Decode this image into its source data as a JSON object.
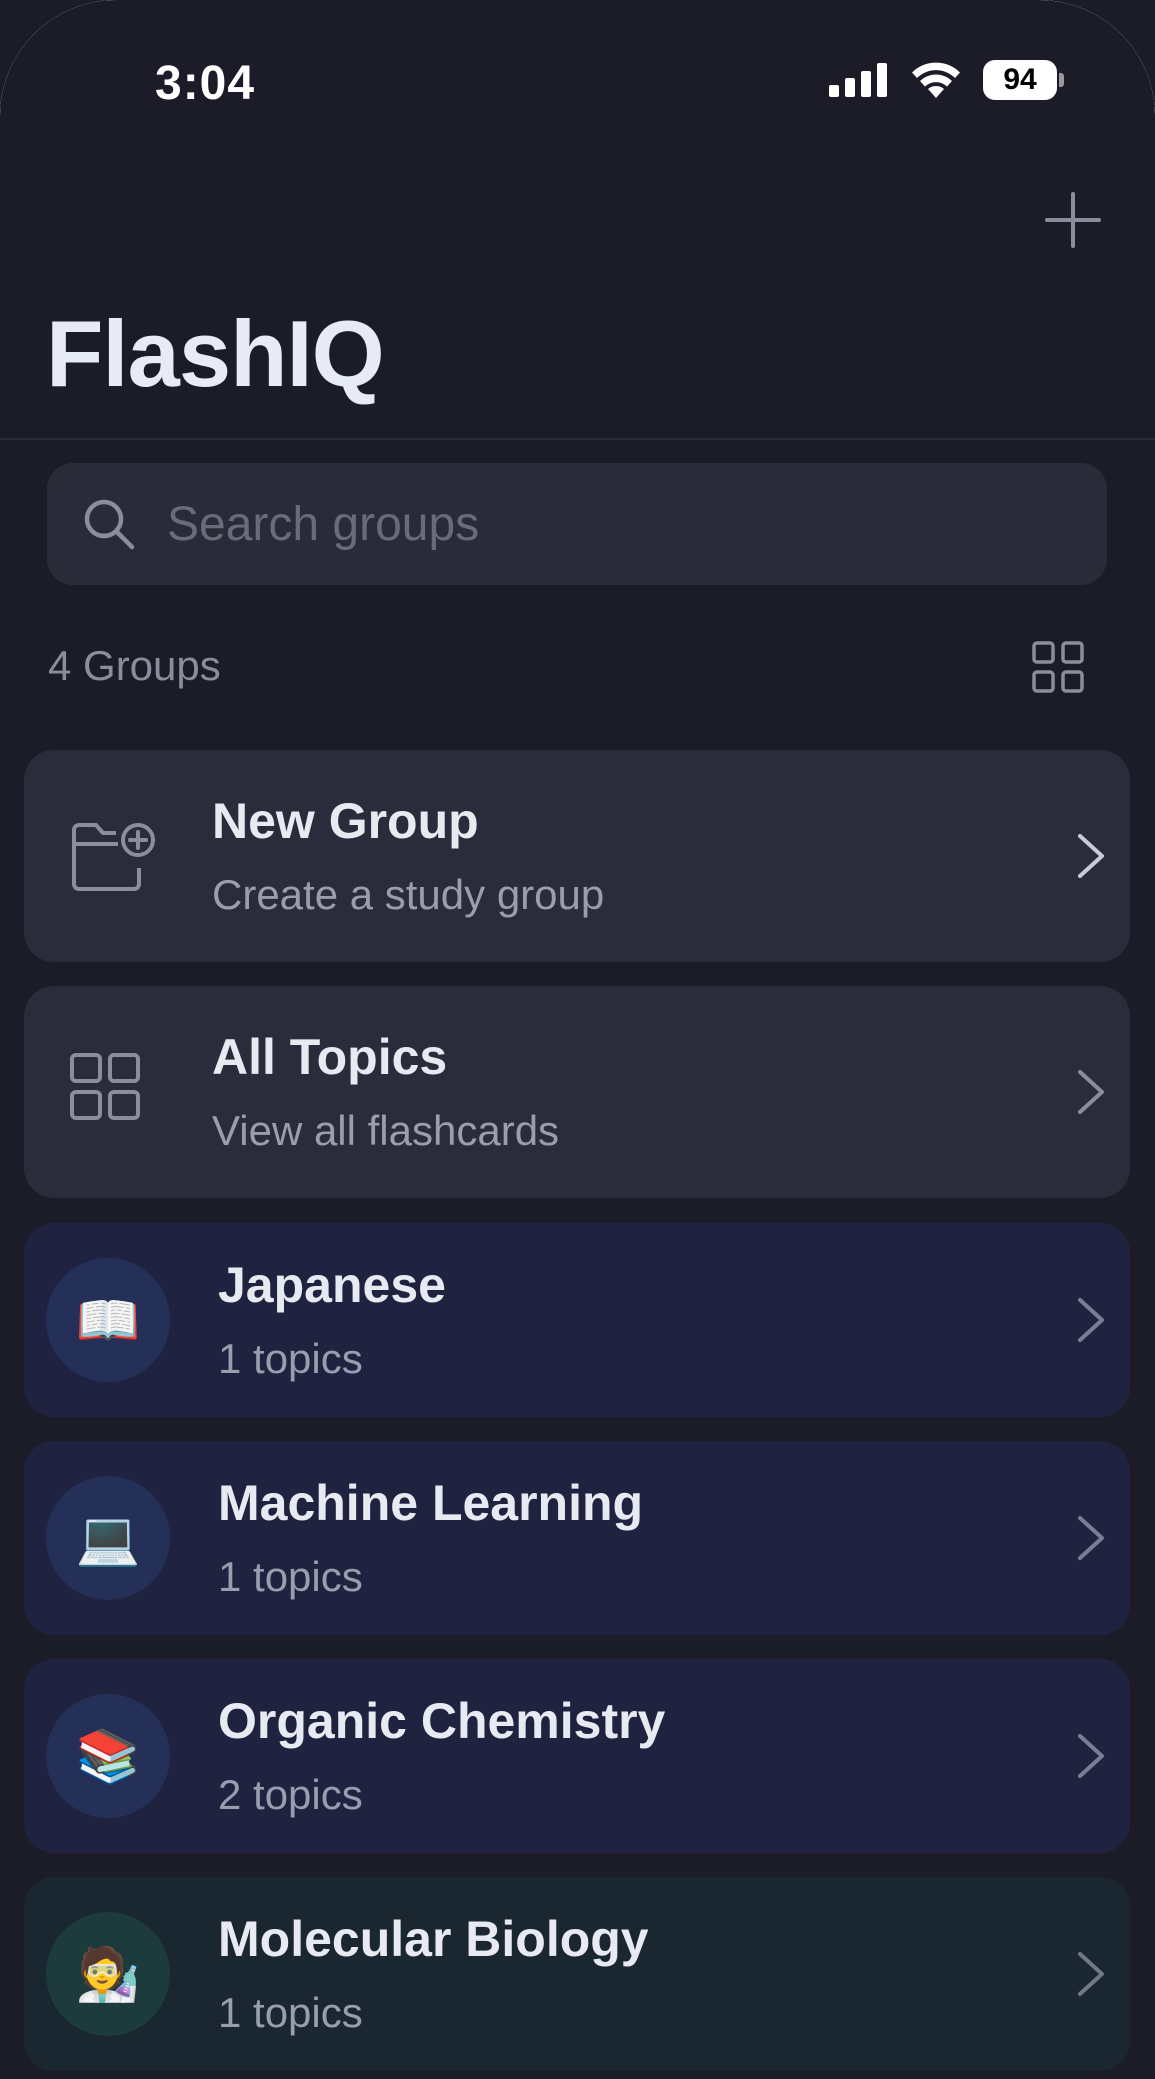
{
  "status_bar": {
    "time": "3:04",
    "battery": "94",
    "icons": [
      "cellular-signal-icon",
      "wifi-icon",
      "battery-icon"
    ]
  },
  "header": {
    "title": "FlashIQ",
    "add_icon": "plus-icon"
  },
  "search": {
    "placeholder": "Search groups",
    "value": ""
  },
  "list_header": {
    "count_label": "4 Groups",
    "view_toggle_icon": "grid-view-icon"
  },
  "actions": [
    {
      "title": "New Group",
      "subtitle": "Create a study group",
      "icon": "folder-add-icon"
    },
    {
      "title": "All Topics",
      "subtitle": "View all flashcards",
      "icon": "grid-icon"
    }
  ],
  "groups": [
    {
      "title": "Japanese",
      "subtitle": "1 topics",
      "emoji": "📖",
      "theme": "blue"
    },
    {
      "title": "Machine Learning",
      "subtitle": "1 topics",
      "emoji": "💻",
      "theme": "blue"
    },
    {
      "title": "Organic Chemistry",
      "subtitle": "2 topics",
      "emoji": "📚",
      "theme": "blue"
    },
    {
      "title": "Molecular Biology",
      "subtitle": "1 topics",
      "emoji": "🧑‍🔬",
      "theme": "green"
    }
  ],
  "colors": {
    "background": "#1c1c28",
    "action_card": "#2b2c3b",
    "group_card_blue": "#1f2340",
    "group_card_green": "#1a2630",
    "title_text": "#e6ebf5",
    "muted_text": "#9a9dad"
  }
}
